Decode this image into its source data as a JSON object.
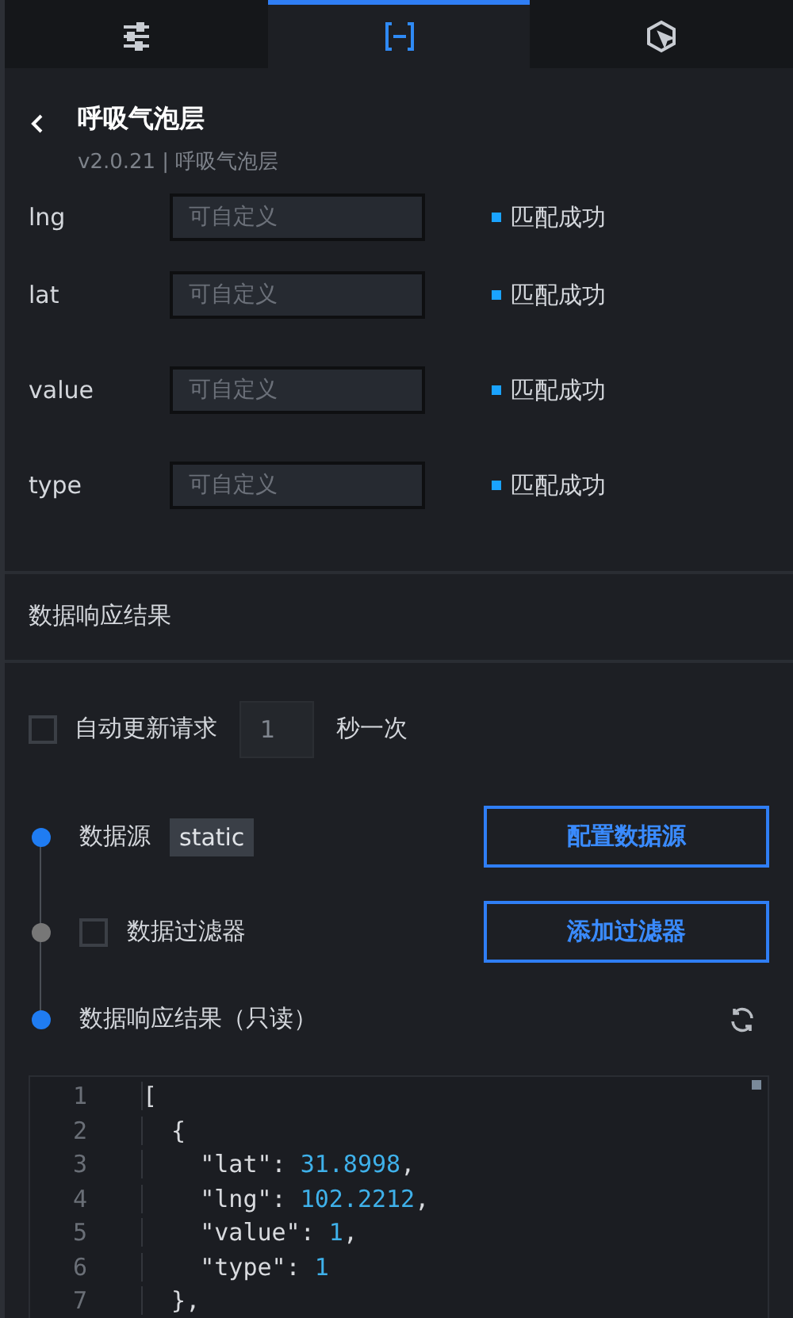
{
  "tabs": [
    {
      "kind": "sliders",
      "selected": false
    },
    {
      "kind": "brackets",
      "selected": true
    },
    {
      "kind": "interaction",
      "selected": false
    }
  ],
  "header": {
    "title": "呼吸气泡层",
    "subtitle": "v2.0.21 | 呼吸气泡层"
  },
  "fields": [
    {
      "label": "lng",
      "placeholder": "可自定义",
      "status": "匹配成功"
    },
    {
      "label": "lat",
      "placeholder": "可自定义",
      "status": "匹配成功"
    },
    {
      "label": "value",
      "placeholder": "可自定义",
      "status": "匹配成功"
    },
    {
      "label": "type",
      "placeholder": "可自定义",
      "status": "匹配成功"
    }
  ],
  "section_title": "数据响应结果",
  "auto_update": {
    "checked": false,
    "label": "自动更新请求",
    "interval": "1",
    "unit": "秒一次"
  },
  "steps": [
    {
      "kind": "source",
      "active": true,
      "label": "数据源",
      "tag": "static",
      "button": "配置数据源"
    },
    {
      "kind": "filter",
      "active": false,
      "checked": false,
      "label": "数据过滤器",
      "button": "添加过滤器"
    },
    {
      "kind": "result",
      "active": true,
      "label": "数据响应结果（只读）"
    }
  ],
  "editor": {
    "lines": [
      {
        "number": "1",
        "code": "["
      },
      {
        "number": "2",
        "code": "  {"
      },
      {
        "number": "3",
        "code": "    \"lat\": 31.8998,"
      },
      {
        "number": "4",
        "code": "    \"lng\": 102.2212,"
      },
      {
        "number": "5",
        "code": "    \"value\": 1,"
      },
      {
        "number": "6",
        "code": "    \"type\": 1"
      },
      {
        "number": "7",
        "code": "  },"
      }
    ]
  }
}
